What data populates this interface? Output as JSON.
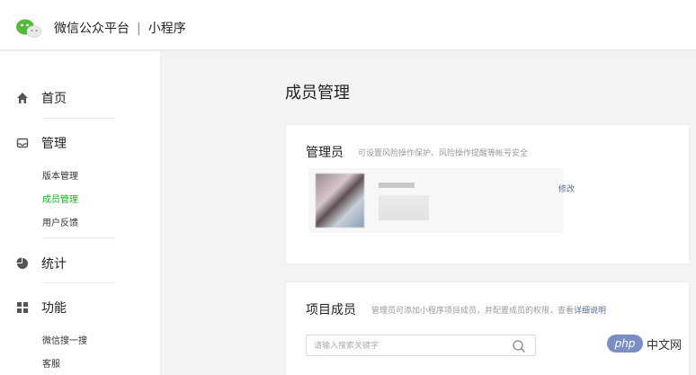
{
  "header": {
    "platform_name": "微信公众平台",
    "separator": "|",
    "section": "小程序",
    "logo_icon": "wechat-logo-icon"
  },
  "sidebar": {
    "groups": [
      {
        "label": "首页",
        "icon": "home-icon",
        "subitems": []
      },
      {
        "label": "管理",
        "icon": "manage-icon",
        "subitems": [
          "版本管理",
          "成员管理",
          "用户反馈"
        ]
      },
      {
        "label": "统计",
        "icon": "stats-pie-icon",
        "subitems": []
      },
      {
        "label": "功能",
        "icon": "grid-icon",
        "subitems": [
          "微信搜一搜",
          "客服"
        ]
      }
    ],
    "active_subitem": "成员管理"
  },
  "main": {
    "title": "成员管理",
    "admin_card": {
      "title": "管理员",
      "description": "可设置风险操作保护、风险操作提醒等帐号安全",
      "edit_label": "修改"
    },
    "members_card": {
      "title": "项目成员",
      "description": "管理员可添加小程序项目成员，并配置成员的权限，查看",
      "link": "详细说明",
      "search_placeholder": "请输入搜索关键字"
    }
  },
  "watermark": {
    "badge": "php",
    "text": "中文网"
  },
  "colors": {
    "accent_green": "#1aad19",
    "link_blue": "#576b95"
  }
}
